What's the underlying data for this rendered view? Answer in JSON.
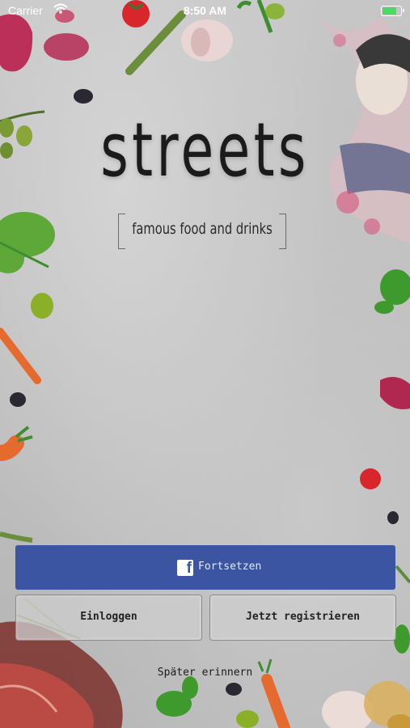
{
  "status_bar": {
    "carrier": "Carrier",
    "time": "8:50 AM"
  },
  "brand": {
    "name": "streets",
    "tagline": "famous food and drinks"
  },
  "actions": {
    "facebook_label": "Fortsetzen",
    "login_label": "Einloggen",
    "register_label": "Jetzt registrieren",
    "later_label": "Später erinnern"
  },
  "colors": {
    "facebook_blue": "#3b55a2",
    "battery_green": "#4cd964"
  },
  "icons": [
    "wifi-icon",
    "battery-icon",
    "facebook-icon"
  ]
}
